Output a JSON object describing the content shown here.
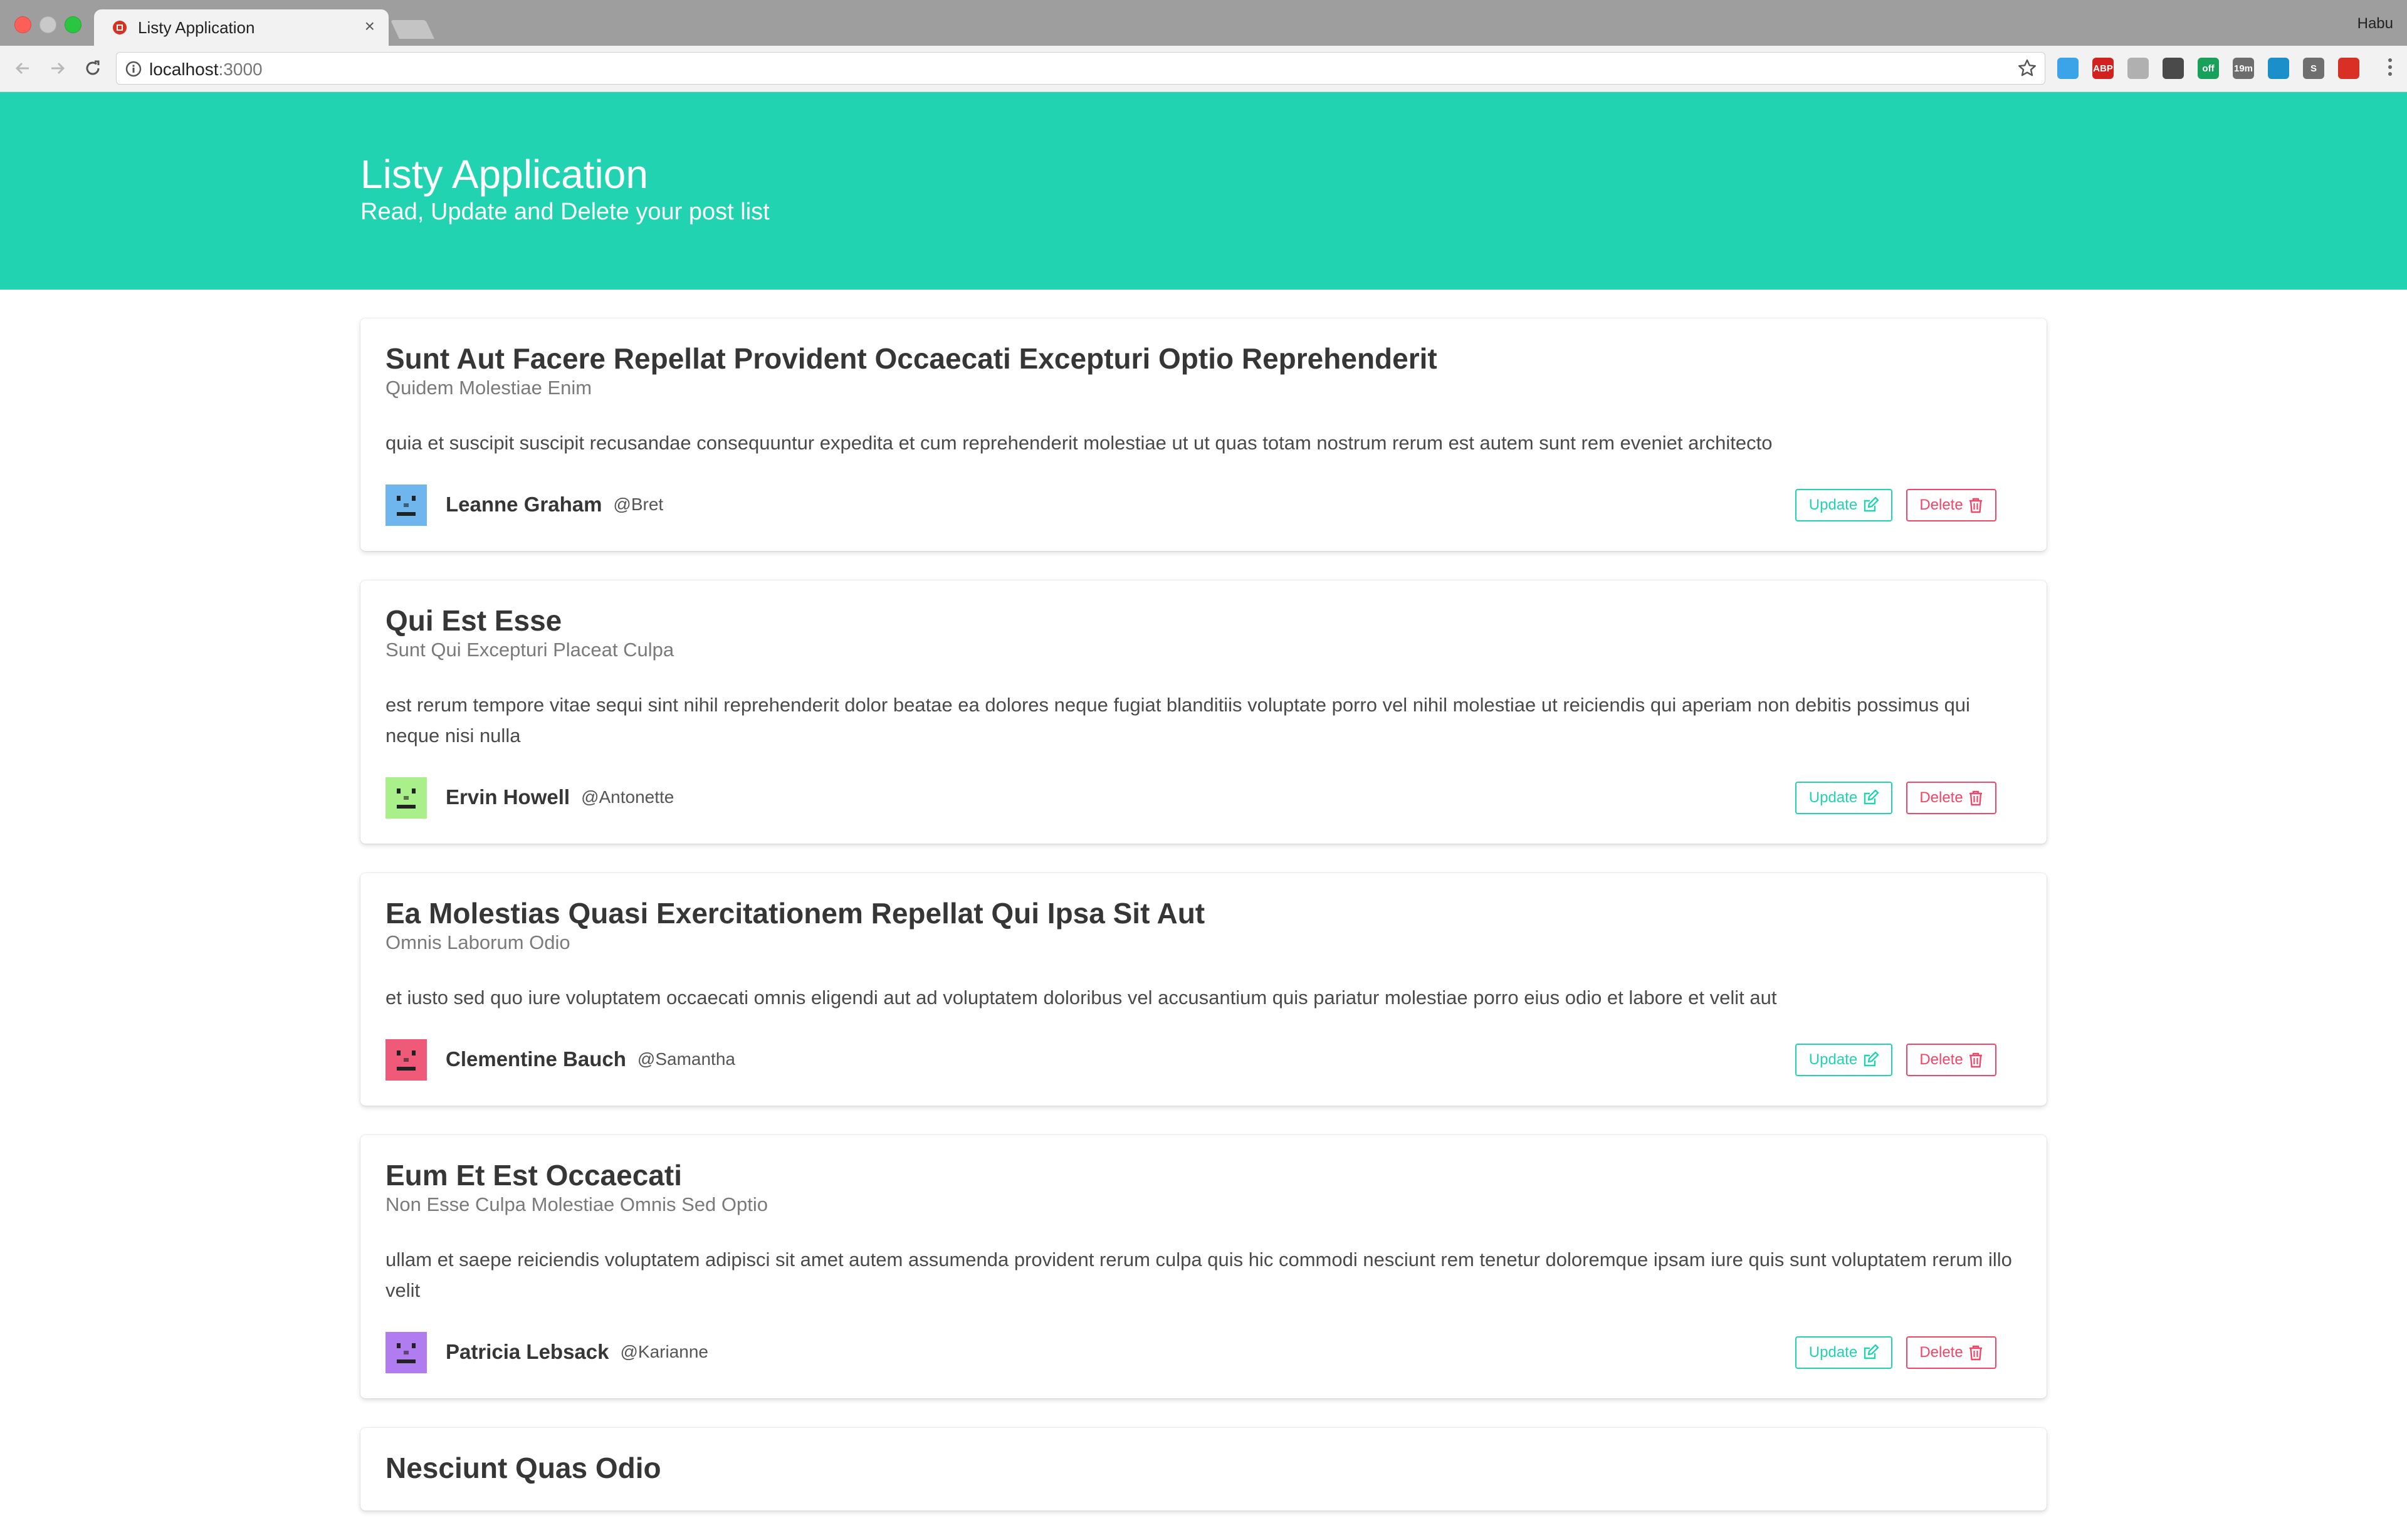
{
  "browser": {
    "tab_title": "Listy Application",
    "tab_close": "×",
    "profile_name": "Habu",
    "url_host": "localhost",
    "url_port": ":3000",
    "extensions": [
      {
        "name": "vivaldi-ext-icon",
        "label": "",
        "color": "#3ba3e8"
      },
      {
        "name": "adblock-plus-icon",
        "label": "ABP",
        "color": "#d2221f"
      },
      {
        "name": "cloud-ext-icon",
        "label": "",
        "color": "#b0b0b0"
      },
      {
        "name": "pocket-icon",
        "label": "",
        "color": "#4a4a4a"
      },
      {
        "name": "grammarly-ext-icon",
        "label": "off",
        "color": "#19a05b"
      },
      {
        "name": "timer-ext-icon",
        "label": "19m",
        "color": "#6d6d6d"
      },
      {
        "name": "shield-ext-icon",
        "label": "",
        "color": "#1b8fc9"
      },
      {
        "name": "s-ext-icon",
        "label": "S",
        "color": "#6f6f6f"
      },
      {
        "name": "red-ext-icon",
        "label": "",
        "color": "#d93025"
      }
    ]
  },
  "header": {
    "title": "Listy Application",
    "subtitle": "Read, Update and Delete your post list"
  },
  "buttons": {
    "update": "Update",
    "delete": "Delete"
  },
  "colors": {
    "primary": "#22d3b2",
    "danger": "#f14668"
  },
  "posts": [
    {
      "title": "Sunt Aut Facere Repellat Provident Occaecati Excepturi Optio Reprehenderit",
      "subtitle": "Quidem Molestiae Enim",
      "body": "quia et suscipit suscipit recusandae consequuntur expedita et cum reprehenderit molestiae ut ut quas totam nostrum rerum est autem sunt rem eveniet architecto",
      "author": "Leanne Graham",
      "username": "@Bret",
      "avatar_color": "#6fb6ee"
    },
    {
      "title": "Qui Est Esse",
      "subtitle": "Sunt Qui Excepturi Placeat Culpa",
      "body": "est rerum tempore vitae sequi sint nihil reprehenderit dolor beatae ea dolores neque fugiat blanditiis voluptate porro vel nihil molestiae ut reiciendis qui aperiam non debitis possimus qui neque nisi nulla",
      "author": "Ervin Howell",
      "username": "@Antonette",
      "avatar_color": "#a9f08a"
    },
    {
      "title": "Ea Molestias Quasi Exercitationem Repellat Qui Ipsa Sit Aut",
      "subtitle": "Omnis Laborum Odio",
      "body": "et iusto sed quo iure voluptatem occaecati omnis eligendi aut ad voluptatem doloribus vel accusantium quis pariatur molestiae porro eius odio et labore et velit aut",
      "author": "Clementine Bauch",
      "username": "@Samantha",
      "avatar_color": "#ef5a78"
    },
    {
      "title": "Eum Et Est Occaecati",
      "subtitle": "Non Esse Culpa Molestiae Omnis Sed Optio",
      "body": "ullam et saepe reiciendis voluptatem adipisci sit amet autem assumenda provident rerum culpa quis hic commodi nesciunt rem tenetur doloremque ipsam iure quis sunt voluptatem rerum illo velit",
      "author": "Patricia Lebsack",
      "username": "@Karianne",
      "avatar_color": "#b07cf0"
    },
    {
      "title": "Nesciunt Quas Odio",
      "subtitle": "",
      "body": "",
      "author": "",
      "username": "",
      "avatar_color": "#cccccc"
    }
  ]
}
